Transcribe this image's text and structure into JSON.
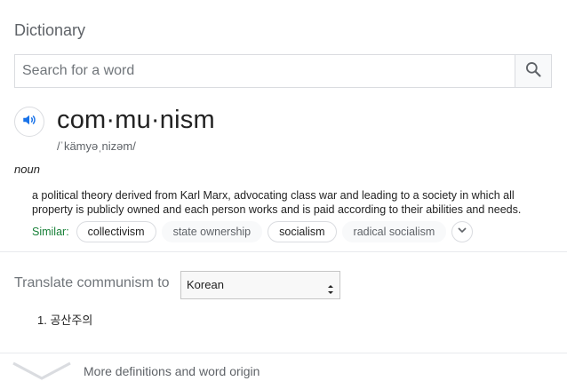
{
  "title": "Dictionary",
  "search": {
    "placeholder": "Search for a word"
  },
  "entry": {
    "word": "com·mu·nism",
    "pronunciation": "/ˈkämyəˌnizəm/",
    "part_of_speech": "noun",
    "definition": "a political theory derived from Karl Marx, advocating class war and leading to a society in which all property is publicly owned and each person works and is paid according to their abilities and needs.",
    "similar_label": "Similar:",
    "similar": [
      {
        "label": "collectivism"
      },
      {
        "label": "state ownership"
      },
      {
        "label": "socialism"
      },
      {
        "label": "radical socialism"
      }
    ]
  },
  "translate": {
    "label": "Translate communism to",
    "selected_language": "Korean",
    "results": [
      "1. 공산주의"
    ]
  },
  "more": {
    "label": "More definitions and word origin"
  },
  "colors": {
    "accent": "#1a73e8",
    "similar_label": "#188038"
  },
  "icons": [
    "search-icon",
    "speaker-icon",
    "chevron-down-icon",
    "select-arrows-icon"
  ]
}
